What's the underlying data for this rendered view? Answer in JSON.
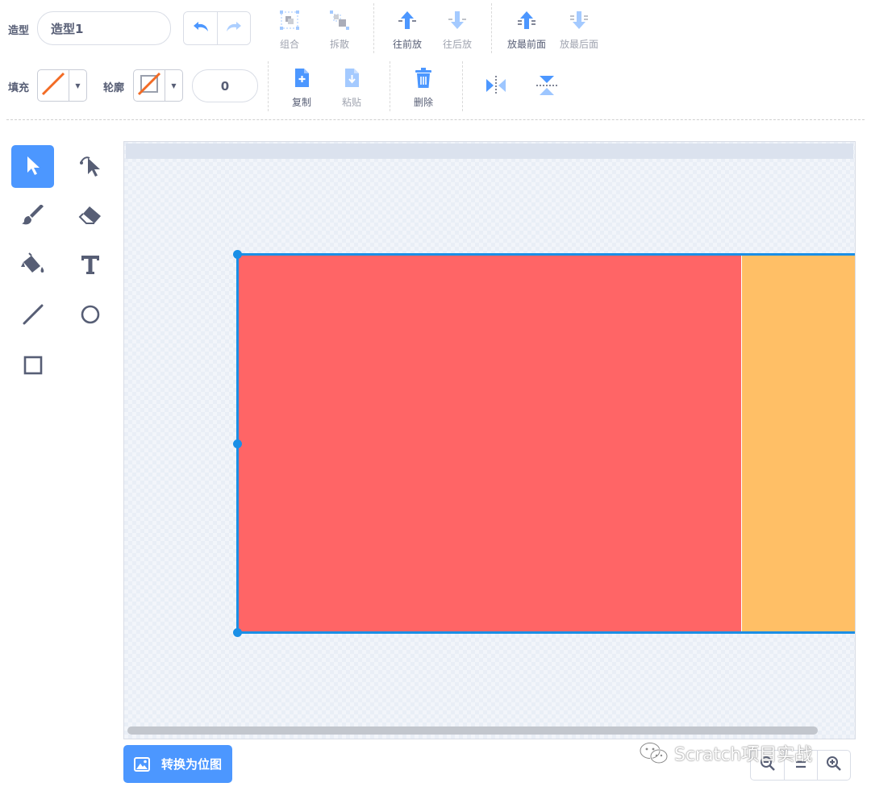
{
  "toolbar": {
    "costume_label": "造型",
    "costume_name": "造型1",
    "group_label": "组合",
    "ungroup_label": "拆散",
    "forward_label": "往前放",
    "backward_label": "往后放",
    "front_label": "放最前面",
    "back_label": "放最后面",
    "fill_label": "填充",
    "outline_label": "轮廓",
    "outline_width": "0",
    "copy_label": "复制",
    "paste_label": "粘贴",
    "delete_label": "删除"
  },
  "tools": [
    "select",
    "reshape",
    "brush",
    "eraser",
    "fill",
    "text",
    "line",
    "circle",
    "rectangle"
  ],
  "active_tool": "select",
  "canvas": {
    "shapes": [
      {
        "name": "red-rectangle",
        "color": "#ff6566"
      },
      {
        "name": "orange-rectangle",
        "color": "#ffbf66"
      }
    ],
    "selection_color": "#1a8fe6"
  },
  "footer": {
    "convert_button": "转换为位图",
    "watermark": "Scratch项目实战"
  },
  "colors": {
    "accent": "#4c97ff",
    "text": "#575e75",
    "fill_none_slash": "#f26b25"
  }
}
